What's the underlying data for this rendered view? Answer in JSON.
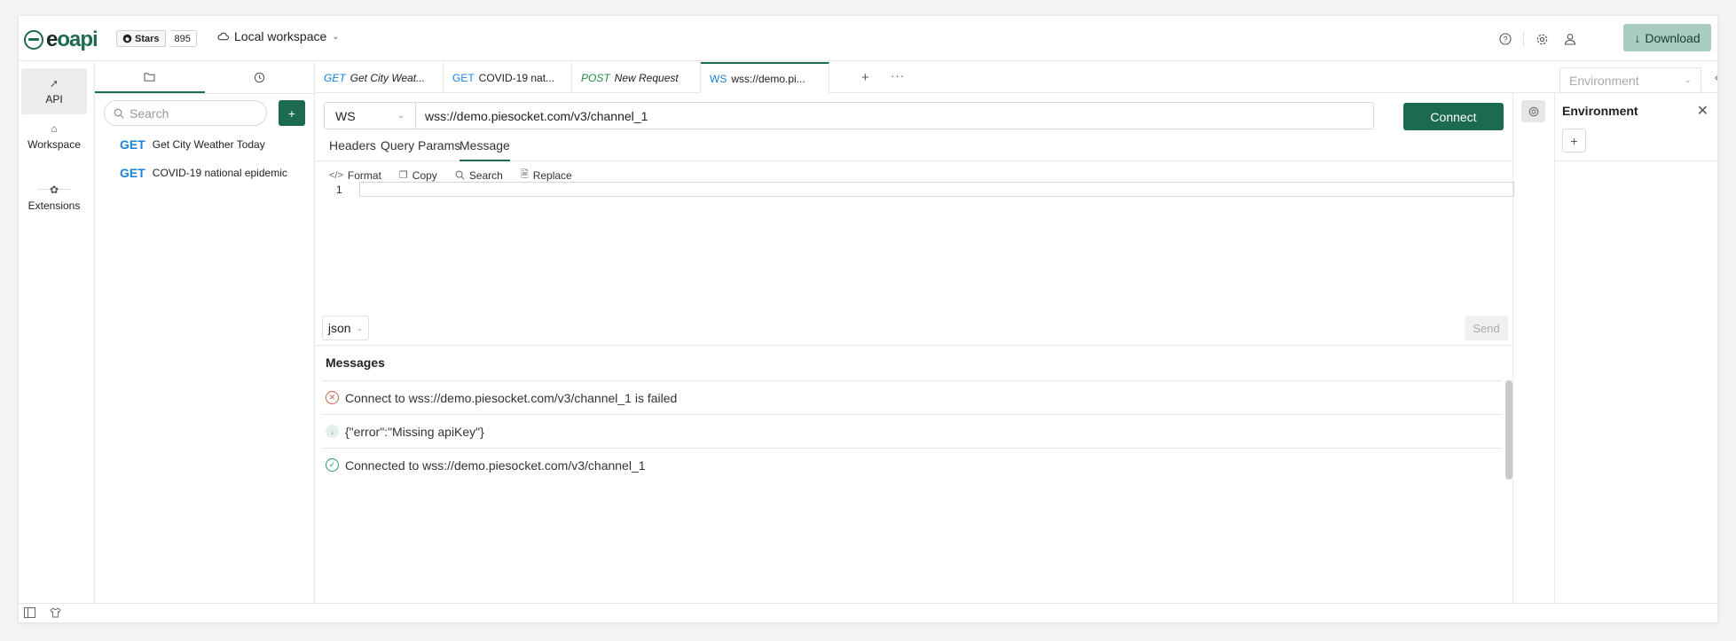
{
  "header": {
    "logo_text_a": "e",
    "logo_text_b": "oapi",
    "stars_label": "Stars",
    "stars_count": "895",
    "workspace": "Local workspace",
    "download_label": "Download"
  },
  "rail": {
    "items": [
      {
        "label": "API"
      },
      {
        "label": "Workspace"
      },
      {
        "label": "Extensions"
      }
    ]
  },
  "tree": {
    "search_placeholder": "Search",
    "add_label": "+",
    "items": [
      {
        "method": "GET",
        "name": "Get City Weather Today"
      },
      {
        "method": "GET",
        "name": "COVID-19 national epidemic"
      }
    ]
  },
  "tabs": [
    {
      "method": "GET",
      "name": "Get City Weat..."
    },
    {
      "method": "GET",
      "name": "COVID-19 nat..."
    },
    {
      "method": "POST",
      "name": "New Request"
    },
    {
      "method": "WS",
      "name": "wss://demo.pi..."
    }
  ],
  "tabbar": {
    "environment_placeholder": "Environment"
  },
  "request": {
    "protocol": "WS",
    "url": "wss://demo.piesocket.com/v3/channel_1",
    "connect_label": "Connect",
    "subtabs": [
      "Headers",
      "Query Params",
      "Message"
    ],
    "toolbar": [
      "Format",
      "Copy",
      "Search",
      "Replace"
    ],
    "line_number": "1",
    "language": "json",
    "send_label": "Send"
  },
  "messages": {
    "title": "Messages",
    "items": [
      {
        "status": "failed",
        "text": "Connect to wss://demo.piesocket.com/v3/channel_1 is failed"
      },
      {
        "status": "received",
        "text": "{\"error\":\"Missing apiKey\"}"
      },
      {
        "status": "success",
        "text": "Connected to wss://demo.piesocket.com/v3/channel_1"
      }
    ]
  },
  "env_panel": {
    "title": "Environment",
    "add_label": "+"
  },
  "colors": {
    "brand": "#1c6b4f",
    "get": "#1a82d8",
    "post": "#1f8a47"
  }
}
